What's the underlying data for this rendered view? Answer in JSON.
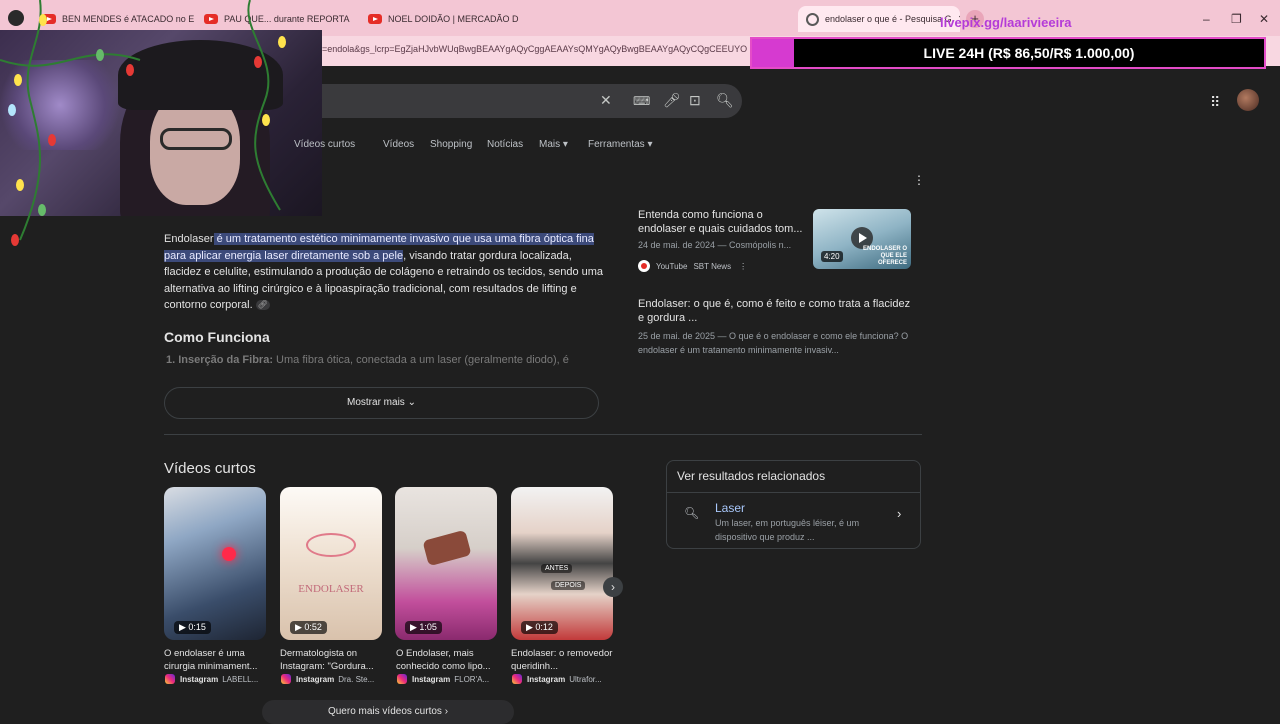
{
  "browser": {
    "tabs": [
      {
        "label": "BEN MENDES é ATACADO no E"
      },
      {
        "label": "PAU QUE... durante REPORTA"
      },
      {
        "label": "NOEL DOIDÃO | MERCADÃO D"
      },
      {
        "label": "endolaser o que é - Pesquisa G"
      }
    ],
    "url": "=endola&gs_lcrp=EgZjaHJvbWUqBwgBEAAYgAQyCggAEAAYsQMYgAQyBwgBEAAYgAQyCQgCEEUYO",
    "new_tab": "+",
    "window_controls": [
      "–",
      "❐",
      "✕"
    ]
  },
  "overlay": {
    "live_text": "LIVE 24H (R$ 86,50/R$ 1.000,00)",
    "pix_link": "livepix.gg/laarivieeira"
  },
  "google": {
    "filters": [
      "Vídeos curtos",
      "Vídeos",
      "Shopping",
      "Notícias",
      "Mais",
      "Ferramentas"
    ],
    "overview": {
      "term": "Endolaser",
      "highlight": " é um tratamento estético minimamente invasivo que usa uma fibra óptica fina para aplicar energia laser diretamente sob a pele",
      "rest": ", visando tratar gordura localizada, flacidez e celulite, estimulando a produção de colágeno e retraindo os tecidos, sendo uma alternativa ao lifting cirúrgico e à lipoaspiração tradicional, com resultados de lifting e contorno corporal.",
      "heading": "Como Funciona",
      "step1_label": "1. Inserção da Fibra:",
      "step1_text": " Uma fibra ótica, conectada a um laser (geralmente diodo), é",
      "show_more": "Mostrar mais"
    },
    "sources": [
      {
        "title": "Entenda como funciona o endolaser e quais cuidados tom...",
        "date": "24 de mai. de 2024 — Cosmópolis n...",
        "site": "YouTube",
        "channel": "SBT News",
        "duration": "4:20",
        "thumb_caption": "ENDOLASER O QUE ELE OFERECE"
      },
      {
        "title": "Endolaser: o que é, como é feito e como trata a flacidez e gordura ...",
        "snippet": "25 de mai. de 2025 — O que é o endolaser e como ele funciona? O endolaser é um tratamento minimamente invasiv..."
      }
    ],
    "short_videos": {
      "title": "Vídeos curtos",
      "items": [
        {
          "duration": "0:15",
          "caption": "O endolaser é uma cirurgia minimament...",
          "platform": "Instagram",
          "author": "LABELL..."
        },
        {
          "duration": "0:52",
          "caption": "Dermatologista on Instagram: \"Gordura...",
          "platform": "Instagram",
          "author": "Dra. Ste...",
          "overlay": "ENDOLASER"
        },
        {
          "duration": "1:05",
          "caption": "O Endolaser, mais conhecido como lipo...",
          "platform": "Instagram",
          "author": "FLOR'A..."
        },
        {
          "duration": "0:12",
          "caption": "Endolaser: o removedor queridinh...",
          "platform": "Instagram",
          "author": "Ultrafor...",
          "before": "ANTES",
          "after": "DEPOIS"
        }
      ],
      "more": "Quero mais vídeos curtos"
    },
    "related": {
      "heading": "Ver resultados relacionados",
      "title": "Laser",
      "snippet": "Um laser, em português léiser, é um dispositivo que produz ..."
    }
  }
}
